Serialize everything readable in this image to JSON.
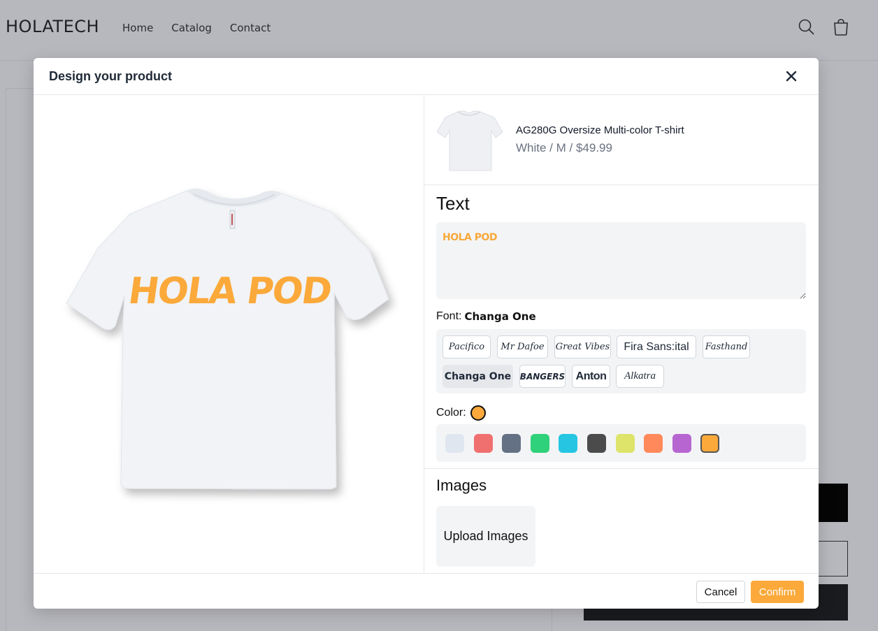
{
  "store": {
    "brand": "HOLATECH",
    "nav": [
      "Home",
      "Catalog",
      "Contact"
    ]
  },
  "modal": {
    "title": "Design your product",
    "product": {
      "name": "AG280G Oversize Multi-color T-shirt",
      "meta": "White / M / $49.99"
    },
    "text_section": {
      "title": "Text",
      "value": "HOLA POD",
      "font_label": "Font:",
      "font_current": "Changa One",
      "fonts": [
        "Pacifico",
        "Mr Dafoe",
        "Great Vibes",
        "Fira Sans:ital",
        "Fasthand",
        "Changa One",
        "BANGERS",
        "Anton",
        "Alkatra"
      ],
      "selected_font_index": 5,
      "color_label": "Color:",
      "colors": [
        "#dfe6ef",
        "#f07070",
        "#647184",
        "#2fd27a",
        "#26c6e2",
        "#4b4b4b",
        "#dde469",
        "#ff895a",
        "#b766d1",
        "#fba93a"
      ],
      "selected_color_index": 9
    },
    "images_section": {
      "title": "Images",
      "upload_label": "Upload Images"
    },
    "footer": {
      "cancel_label": "Cancel",
      "confirm_label": "Confirm"
    },
    "preview_text": "HOLA POD",
    "accent_color": "#fba93a"
  },
  "icons": {
    "search": "search-icon",
    "cart": "cart-icon",
    "close": "close-icon"
  }
}
